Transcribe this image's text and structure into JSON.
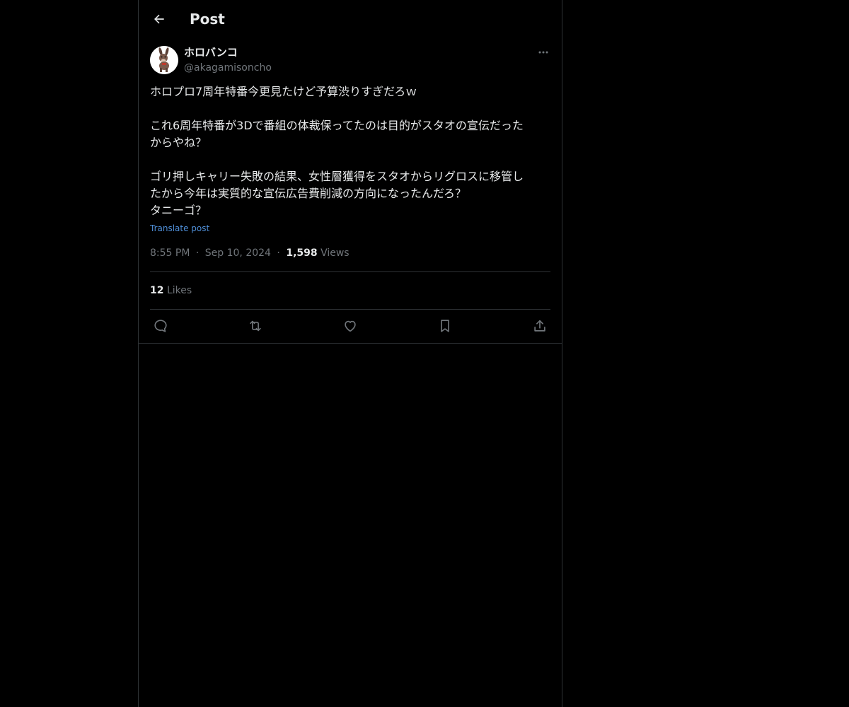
{
  "header": {
    "title": "Post",
    "back_icon": "arrow-left-icon"
  },
  "author": {
    "name": "ホロバンコ",
    "handle": "@akagamisoncho",
    "avatar": "donkey-avatar"
  },
  "post": {
    "lines": [
      "ホロプロ7周年特番今更見たけど予算渋りすぎだろｗ",
      "",
      "これ6周年特番が3Dで番組の体裁保ってたのは目的がスタオの宣伝だった",
      "からやね？",
      "",
      "ゴリ押しキャリー失敗の結果、女性層獲得をスタオからリグロスに移管し",
      "たから今年は実質的な宣伝広告費削減の方向になったんだろ？",
      "タニーゴ？"
    ],
    "translate_label": "Translate post"
  },
  "meta": {
    "time": "8:55 PM",
    "separator": "·",
    "date": "Sep 10, 2024",
    "views_count": "1,598",
    "views_label": "Views"
  },
  "engagement": {
    "likes_count": "12",
    "likes_label": "Likes"
  },
  "actions": [
    "reply-icon",
    "repost-icon",
    "like-icon",
    "bookmark-icon",
    "share-icon"
  ],
  "colors": {
    "background": "#000000",
    "text": "#e7e9ea",
    "muted": "#71767b",
    "link": "#4f8fd8",
    "border": "#2f3336"
  }
}
